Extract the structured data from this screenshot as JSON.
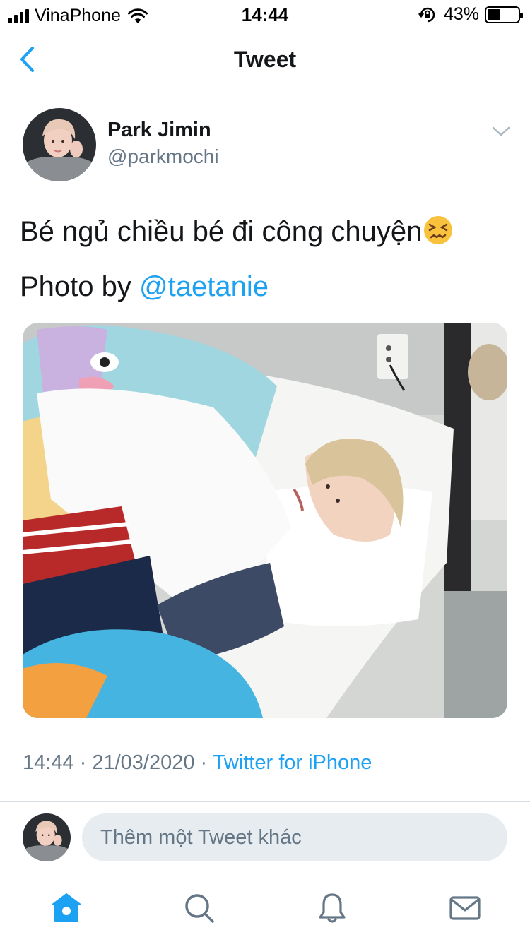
{
  "status_bar": {
    "carrier": "VinaPhone",
    "time": "14:44",
    "battery": "43%",
    "battery_level": 0.43
  },
  "nav": {
    "title": "Tweet",
    "back_icon": "chevron-left-icon"
  },
  "tweet": {
    "author_name": "Park Jimin",
    "author_handle": "@parkmochi",
    "text_line1": "Bé ngủ chiều bé đi công chuyện",
    "emoji_icon": "confounded-face-emoji",
    "text_line2_prefix": "Photo by ",
    "mention": "@taetanie",
    "meta_datetime": "14:44 · 21/03/2020 · ",
    "meta_source": "Twitter for iPhone"
  },
  "reply": {
    "placeholder": "Thêm một Tweet khác"
  },
  "tab_bar": {
    "items": [
      "home-icon",
      "search-icon",
      "notifications-bell-icon",
      "messages-envelope-icon"
    ],
    "active": "home-icon"
  },
  "colors": {
    "accent": "#1da1f2",
    "text_primary": "#14171a",
    "text_secondary": "#657786",
    "input_bg": "#e6ecf0"
  }
}
